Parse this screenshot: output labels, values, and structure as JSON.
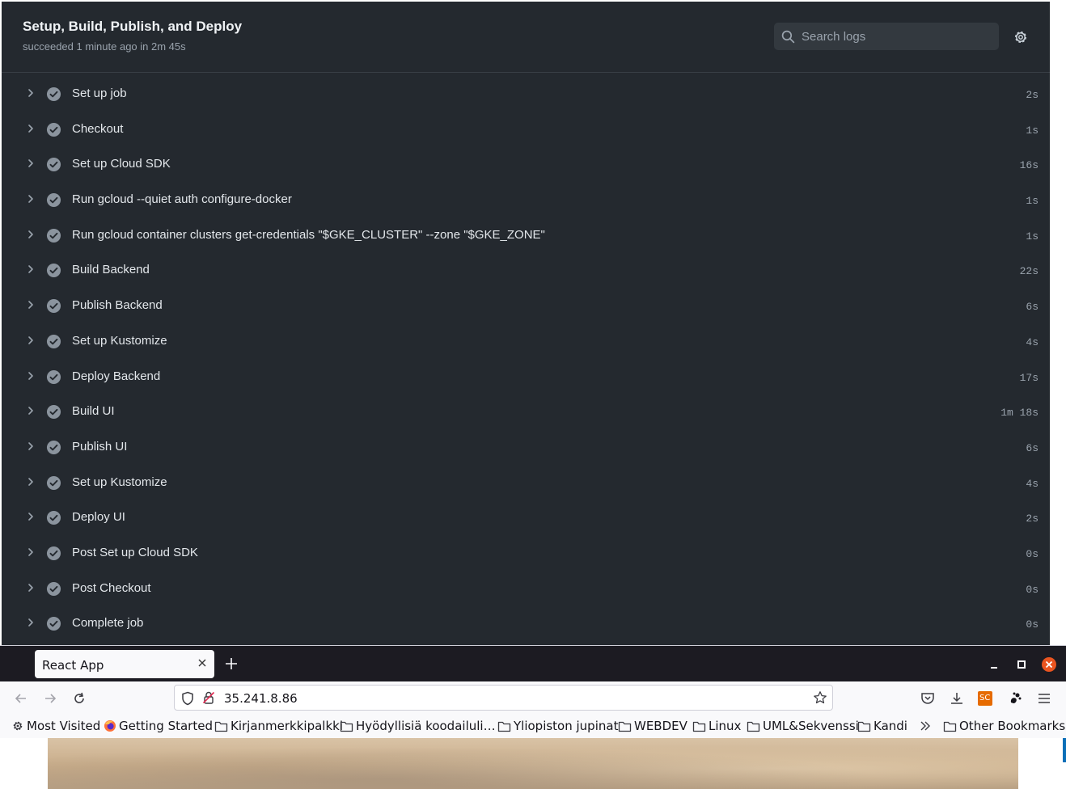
{
  "job": {
    "title": "Setup, Build, Publish, and Deploy",
    "status": "succeeded 1 minute ago in 2m 45s",
    "search_placeholder": "Search logs"
  },
  "steps": [
    {
      "name": "Set up job",
      "duration": "2s"
    },
    {
      "name": "Checkout",
      "duration": "1s"
    },
    {
      "name": "Set up Cloud SDK",
      "duration": "16s"
    },
    {
      "name": "Run gcloud --quiet auth configure-docker",
      "duration": "1s"
    },
    {
      "name": "Run gcloud container clusters get-credentials \"$GKE_CLUSTER\" --zone \"$GKE_ZONE\"",
      "duration": "1s"
    },
    {
      "name": "Build Backend",
      "duration": "22s"
    },
    {
      "name": "Publish Backend",
      "duration": "6s"
    },
    {
      "name": "Set up Kustomize",
      "duration": "4s"
    },
    {
      "name": "Deploy Backend",
      "duration": "17s"
    },
    {
      "name": "Build UI",
      "duration": "1m 18s"
    },
    {
      "name": "Publish UI",
      "duration": "6s"
    },
    {
      "name": "Set up Kustomize",
      "duration": "4s"
    },
    {
      "name": "Deploy UI",
      "duration": "2s"
    },
    {
      "name": "Post Set up Cloud SDK",
      "duration": "0s"
    },
    {
      "name": "Post Checkout",
      "duration": "0s"
    },
    {
      "name": "Complete job",
      "duration": "0s"
    }
  ],
  "browser": {
    "tab_title": "React App",
    "url": "35.241.8.86",
    "bookmarks": [
      {
        "label": "Most Visited",
        "icon": "gear-icon"
      },
      {
        "label": "Getting Started",
        "icon": "firefox-icon"
      },
      {
        "label": "Kirjanmerkkipalkki",
        "icon": "folder-icon"
      },
      {
        "label": "Hyödyllisiä koodailuli…",
        "icon": "folder-icon"
      },
      {
        "label": "Yliopiston jupinat",
        "icon": "folder-icon"
      },
      {
        "label": "WEBDEV",
        "icon": "folder-icon"
      },
      {
        "label": "Linux",
        "icon": "folder-icon"
      },
      {
        "label": "UML&Sekvenssi",
        "icon": "folder-icon"
      },
      {
        "label": "Kandi",
        "icon": "folder-icon"
      }
    ],
    "other_bookmarks": "Other Bookmarks",
    "extension_label": "SC"
  },
  "colors": {
    "panel_bg": "#24292f",
    "check_bg": "#8b949e",
    "close_button": "#e95420",
    "extension_bg": "#e66b00"
  }
}
